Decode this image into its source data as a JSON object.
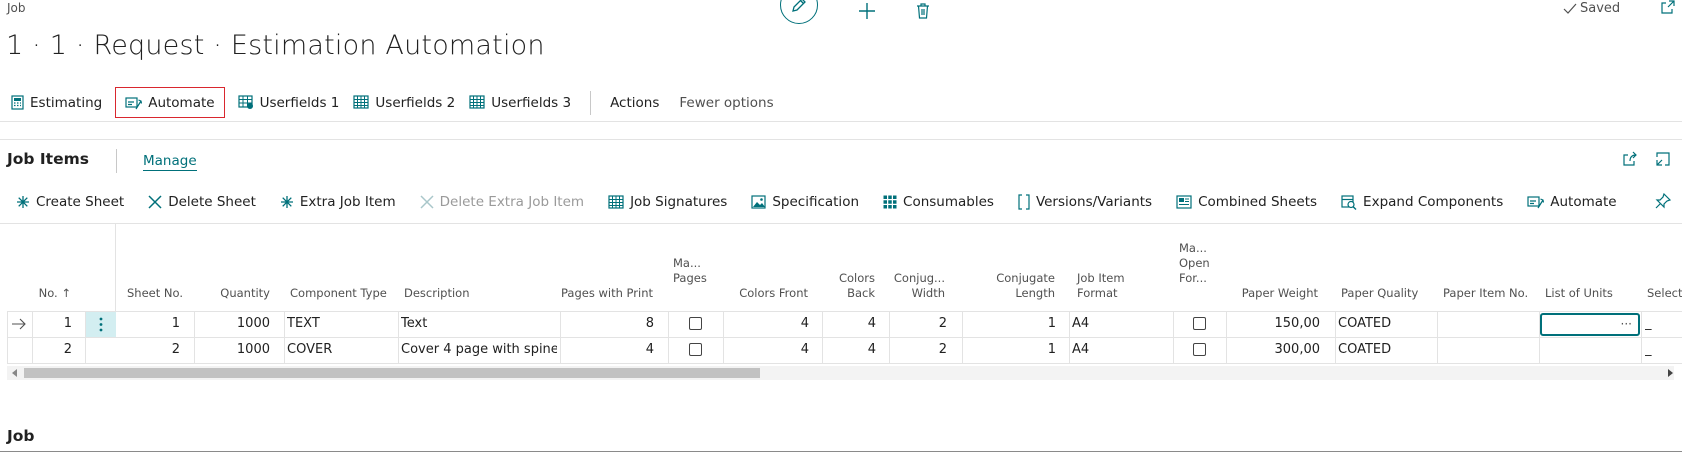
{
  "header": {
    "breadcrumb": "Job",
    "title": "1 · 1 · Request · Estimation Automation",
    "saved_label": "Saved"
  },
  "action_bar": {
    "items": [
      {
        "label": "Estimating",
        "icon": "calculator-icon"
      },
      {
        "label": "Automate",
        "icon": "automate-icon",
        "highlighted": true
      },
      {
        "label": "Userfields 1",
        "icon": "userfields-icon"
      },
      {
        "label": "Userfields 2",
        "icon": "userfields-icon"
      },
      {
        "label": "Userfields 3",
        "icon": "userfields-icon"
      }
    ],
    "actions_label": "Actions",
    "fewer_options_label": "Fewer options"
  },
  "subpage": {
    "title": "Job Items",
    "manage_tab": "Manage",
    "commands": [
      {
        "label": "Create Sheet",
        "icon": "create-icon",
        "enabled": true
      },
      {
        "label": "Delete Sheet",
        "icon": "delete-x-icon",
        "enabled": true
      },
      {
        "label": "Extra Job Item",
        "icon": "create-icon",
        "enabled": true
      },
      {
        "label": "Delete Extra Job Item",
        "icon": "delete-x-icon",
        "enabled": false
      },
      {
        "label": "Job Signatures",
        "icon": "signatures-icon",
        "enabled": true
      },
      {
        "label": "Specification",
        "icon": "image-icon",
        "enabled": true
      },
      {
        "label": "Consumables",
        "icon": "grid-icon",
        "enabled": true
      },
      {
        "label": "Versions/Variants",
        "icon": "brackets-icon",
        "enabled": true
      },
      {
        "label": "Combined Sheets",
        "icon": "combined-icon",
        "enabled": true
      },
      {
        "label": "Expand Components",
        "icon": "expand-icon",
        "enabled": true
      },
      {
        "label": "Automate",
        "icon": "automate-icon",
        "enabled": true
      }
    ]
  },
  "table": {
    "columns": [
      {
        "key": "no",
        "label": "No. ↑"
      },
      {
        "key": "sheet_no",
        "label": "Sheet No."
      },
      {
        "key": "quantity",
        "label": "Quantity"
      },
      {
        "key": "component_type",
        "label": "Component Type"
      },
      {
        "key": "description",
        "label": "Description"
      },
      {
        "key": "pages_with_print",
        "label": "Pages with Print"
      },
      {
        "key": "ma_pages",
        "label": "Ma... Pages"
      },
      {
        "key": "colors_front",
        "label": "Colors Front"
      },
      {
        "key": "colors_back",
        "label": "Colors Back"
      },
      {
        "key": "conjugate_width",
        "label": "Conjug... Width"
      },
      {
        "key": "conjugate_length",
        "label": "Conjugate Length"
      },
      {
        "key": "job_item_format",
        "label": "Job Item Format"
      },
      {
        "key": "ma_open_for",
        "label": "Ma... Open For..."
      },
      {
        "key": "paper_weight",
        "label": "Paper Weight"
      },
      {
        "key": "paper_quality",
        "label": "Paper Quality"
      },
      {
        "key": "paper_item_no",
        "label": "Paper Item No."
      },
      {
        "key": "list_of_units",
        "label": "List of Units"
      },
      {
        "key": "selected",
        "label": "Selecte"
      }
    ],
    "rows": [
      {
        "no": "1",
        "sheet_no": "1",
        "quantity": "1000",
        "component_type": "TEXT",
        "description": "Text",
        "pages_with_print": "8",
        "ma_pages": false,
        "colors_front": "4",
        "colors_back": "4",
        "conjugate_width": "2",
        "conjugate_length": "1",
        "job_item_format": "A4",
        "ma_open_for": false,
        "paper_weight": "150,00",
        "paper_quality": "COATED",
        "paper_item_no": "",
        "list_of_units": "",
        "selected": "_"
      },
      {
        "no": "2",
        "sheet_no": "2",
        "quantity": "1000",
        "component_type": "COVER",
        "description": "Cover 4 page with spine",
        "pages_with_print": "4",
        "ma_pages": false,
        "colors_front": "4",
        "colors_back": "4",
        "conjugate_width": "2",
        "conjugate_length": "1",
        "job_item_format": "A4",
        "ma_open_for": false,
        "paper_weight": "300,00",
        "paper_quality": "COATED",
        "paper_item_no": "",
        "list_of_units": "",
        "selected": "_"
      }
    ],
    "lookup_button": "···"
  },
  "job_section": {
    "title": "Job"
  },
  "colors": {
    "accent": "#00707a",
    "highlight_border": "#d9272e",
    "selected_cell": "#d3eef1"
  }
}
